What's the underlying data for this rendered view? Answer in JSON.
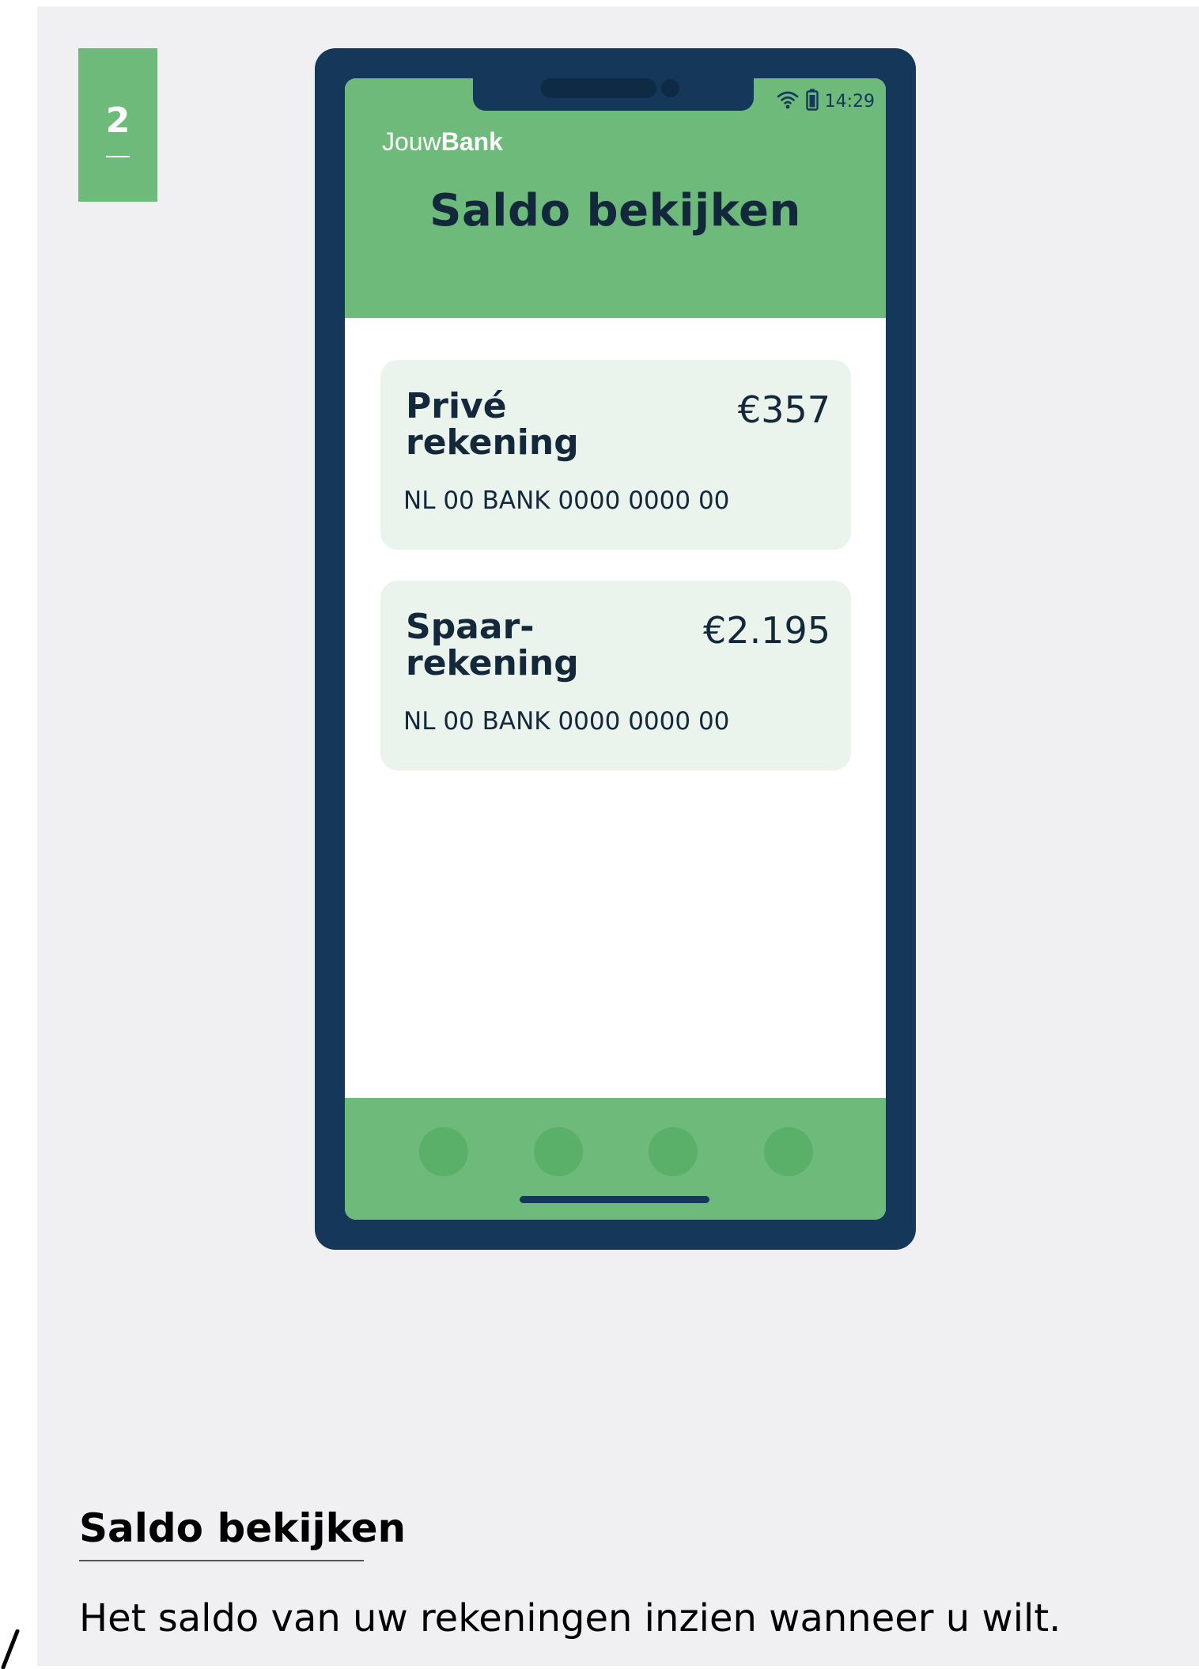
{
  "step": {
    "number": "2"
  },
  "status_bar": {
    "time": "14:29",
    "wifi_icon": "wifi-icon",
    "battery_icon": "battery-icon"
  },
  "app": {
    "brand_prefix": "Jouw",
    "brand_bold": "Bank",
    "screen_title": "Saldo bekijken"
  },
  "accounts": [
    {
      "name_line1": "Privé",
      "name_line2": "rekening",
      "amount": "€357",
      "iban": "NL 00 BANK 0000 0000 00"
    },
    {
      "name_line1": "Spaar-",
      "name_line2": "rekening",
      "amount": "€2.195",
      "iban": "NL 00 BANK 0000 0000 00"
    }
  ],
  "caption": {
    "title": "Saldo bekijken",
    "text": "Het saldo van uw rekeningen inzien wanneer u wilt."
  },
  "colors": {
    "brand_green": "#6dba7a",
    "card_bg": "#eaf4ec",
    "phone_frame": "#14375a",
    "text_dark": "#14283c"
  }
}
